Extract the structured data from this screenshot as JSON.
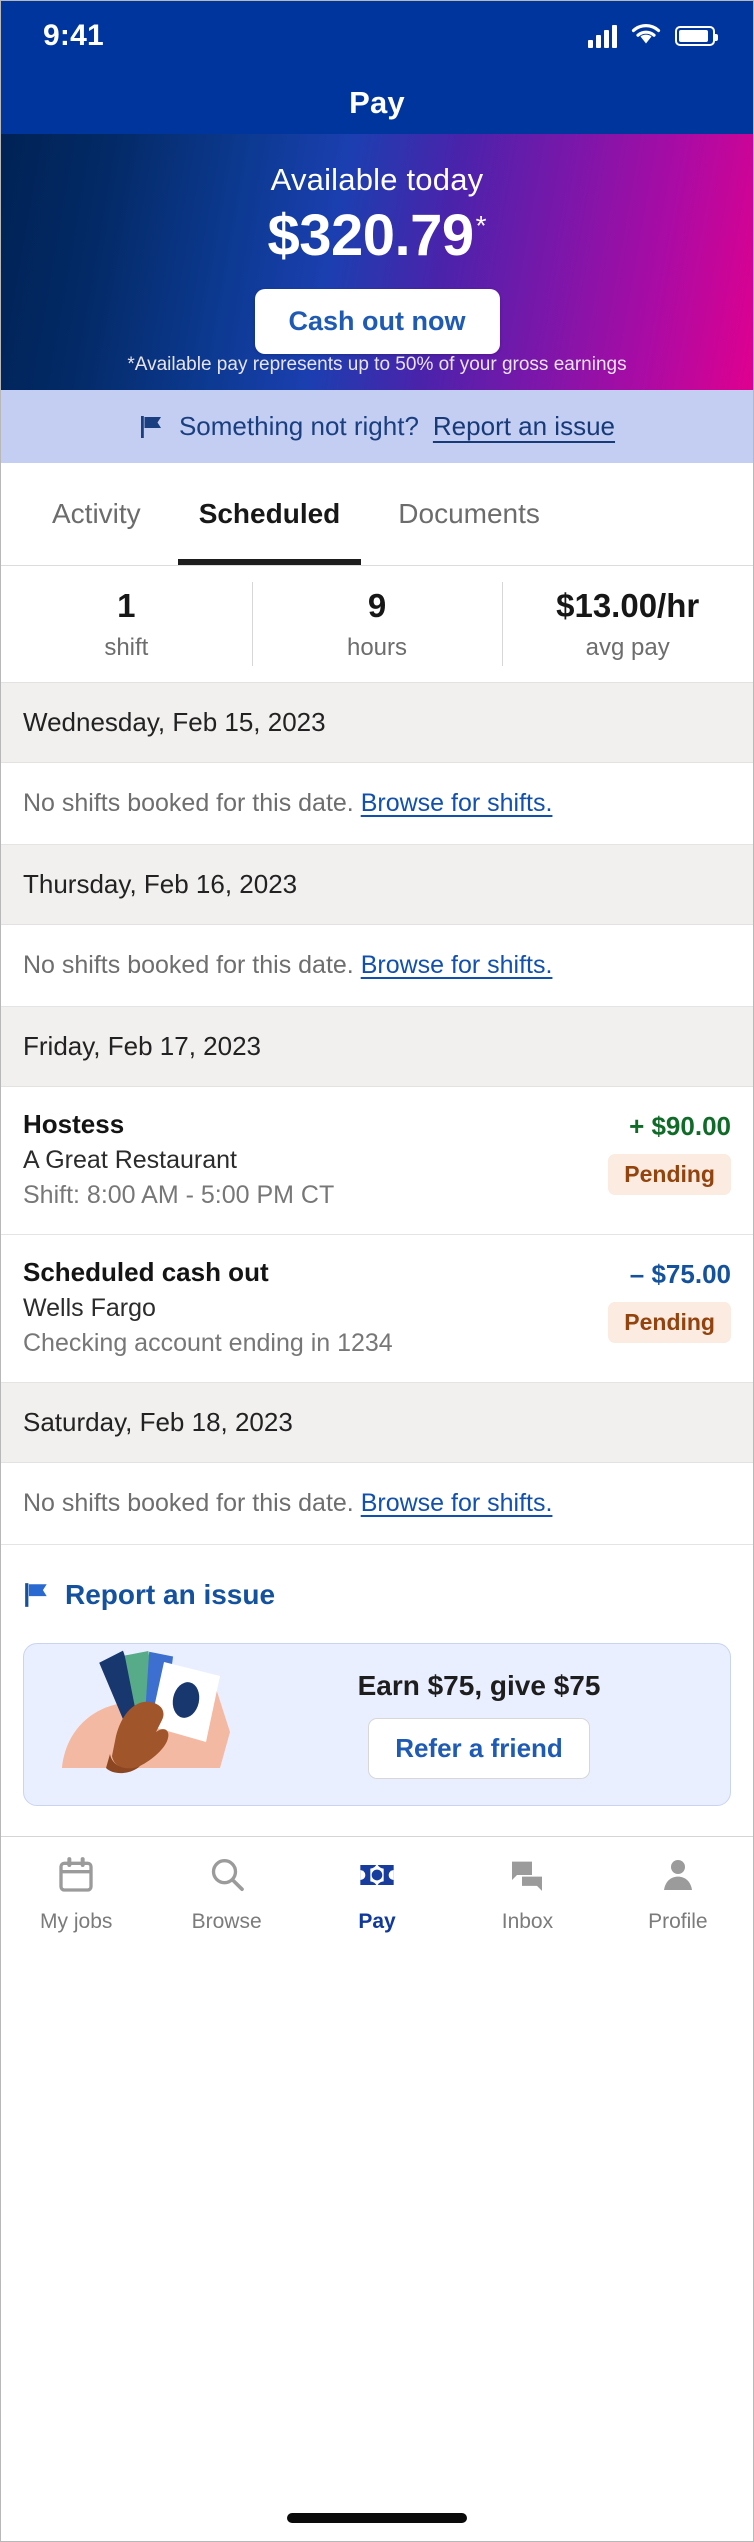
{
  "status_bar": {
    "time": "9:41",
    "icons": [
      "cellular-signal-icon",
      "wifi-icon",
      "battery-icon"
    ]
  },
  "header": {
    "title": "Pay"
  },
  "hero": {
    "label": "Available today",
    "amount": "$320.79",
    "asterisk": "*",
    "cash_out_label": "Cash out now",
    "disclaimer": "*Available pay represents up to 50% of your gross earnings",
    "gradient_from": "#002255",
    "gradient_mid": "#1b3fb0",
    "gradient_to": "#e0008f"
  },
  "report_banner": {
    "icon": "flag-icon",
    "text": "Something not right?",
    "link": "Report an issue",
    "background": "#c4cdf2",
    "text_color": "#1a3f80"
  },
  "tabs": [
    {
      "label": "Activity",
      "active": false
    },
    {
      "label": "Scheduled",
      "active": true
    },
    {
      "label": "Documents",
      "active": false
    }
  ],
  "stats": [
    {
      "value": "1",
      "label": "shift"
    },
    {
      "value": "9",
      "label": "hours"
    },
    {
      "value": "$13.00/hr",
      "label": "avg pay"
    }
  ],
  "days": [
    {
      "date": "Wednesday, Feb 15, 2023",
      "empty_text": "No shifts booked for this date.",
      "empty_link": "Browse for shifts."
    },
    {
      "date": "Thursday, Feb 16, 2023",
      "empty_text": "No shifts booked for this date.",
      "empty_link": "Browse for shifts."
    },
    {
      "date": "Friday, Feb 17, 2023",
      "entries": [
        {
          "title": "Hostess",
          "subtitle": "A Great Restaurant",
          "meta": "Shift: 8:00 AM - 5:00 PM CT",
          "amount": "+ $90.00",
          "amount_type": "credit",
          "amount_color": "#106b28",
          "badge": "Pending"
        },
        {
          "title": "Scheduled cash out",
          "subtitle": "Wells Fargo",
          "meta": "Checking account ending in 1234",
          "amount": "– $75.00",
          "amount_type": "debit",
          "amount_color": "#14529e",
          "badge": "Pending"
        }
      ]
    },
    {
      "date": "Saturday, Feb 18, 2023",
      "empty_text": "No shifts booked for this date.",
      "empty_link": "Browse for shifts."
    }
  ],
  "report_issue": {
    "icon": "flag-icon",
    "label": "Report an issue",
    "color": "#14519e"
  },
  "referral": {
    "illustration": "hand-holding-cards-illustration",
    "title": "Earn $75, give $75",
    "button_label": "Refer a friend",
    "card_background": "#eaefff",
    "card_border": "#c9d4f2"
  },
  "bottom_nav": [
    {
      "label": "My jobs",
      "icon": "calendar-icon",
      "active": false
    },
    {
      "label": "Browse",
      "icon": "search-icon",
      "active": false
    },
    {
      "label": "Pay",
      "icon": "banknote-icon",
      "active": true
    },
    {
      "label": "Inbox",
      "icon": "chat-bubbles-icon",
      "active": false
    },
    {
      "label": "Profile",
      "icon": "person-icon",
      "active": false
    }
  ]
}
